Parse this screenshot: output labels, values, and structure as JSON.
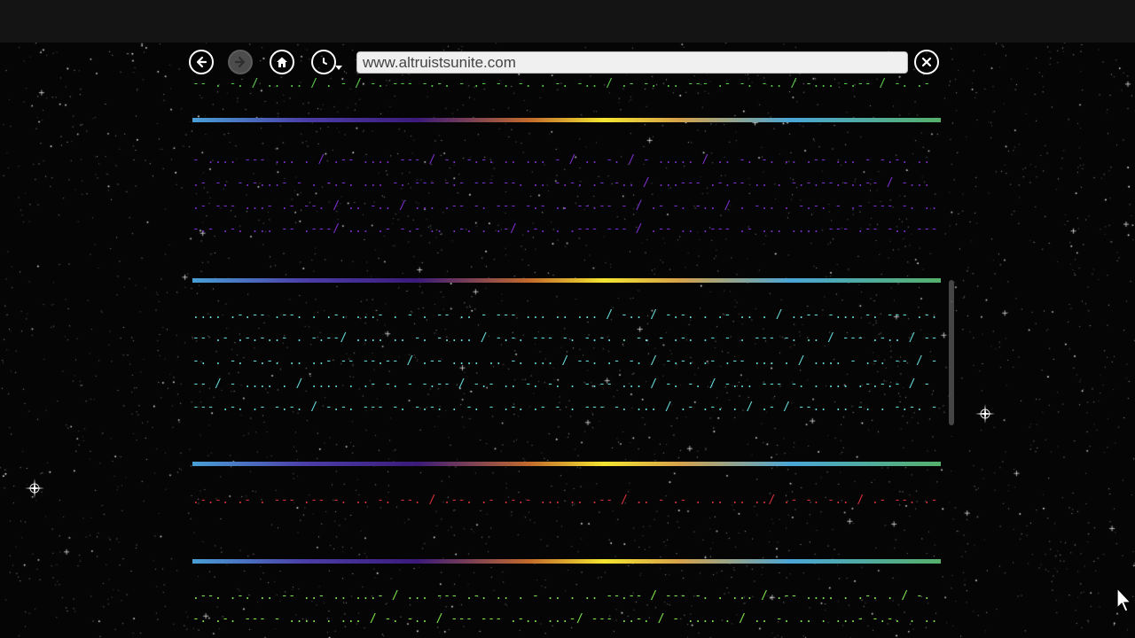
{
  "browser": {
    "url": "www.altruistsunite.com",
    "back_icon": "arrow-left-icon",
    "forward_icon": "arrow-right-icon",
    "home_icon": "home-icon",
    "history_icon": "clock-icon",
    "close_icon": "close-icon"
  },
  "content": {
    "line_top": "-- . -. / .. .. / . - / -. --- -.-. - .- -. -. . -. -.. / .- -. .. --- .- -. -.. / -... -.-- / -. .- - .- -. .- -.-.",
    "block_purple": "- .... --- ... . / .-- .... --- / -. -.-. .. ... - / .. -. / - ..... / .. -. -. .. .-- ... - -.-. .. .- -. -.-...- - . -.-. ... -. --- -.- --- --. .. -.-. .- -.. / ...--- .-.-- .. . -.-.--.-..-- / -... .- --- ...- .- --. / .. -.. / ... .-- -. --- -.- .. --.-- - / .- -. -.. / . -.. . -.-. - .- --- -. .. -.- .-. ... -- .---/ ... .- -.- .. .-. . .-/ .-. . .--- --- / .-- .. .--- .- ... .... --- .-- -.. --- -- . -.-.-.- -. / .-- .- ---- ..-. . .. -- .. .-.-",
    "block_cyan": ".... .-.-- .--. . .-. ...- . - . -- .. - --- ... .. ... / -.. / -.-. . .- .. . / ..-- -... -. --- .-. -- .- .-.-..- . -.--/ .... .. -. -.... / -.-. --- -. -.-. . -. - .-. .- - . --- -. .. / --- .-.. / -- -. . -. -.-. .. ..- -- --.-- / .-- .... .. -. ... / --. .- -. / -.-. .- .-- ... . / .... - .-. -- / --- / - .... . / .... . .- -. - -.-- / -.- .. -. -. . -.-- ... / -. -. / -... --- -. . ... .-.-.- / - --- .-. .- -.-. / -.-. --- -. -.-. . -. - .-. .- - . --- -. ... / .- .-. . / .- / --.. .. -. . -.-. - / -.-. . . ... .- .-.. - / --- .-. / . -.. .-. .-- --- ... .- .-. .- . / - --- / - .... . / ... .- -. .-.-.-",
    "block_red": ".-.-. .- . --- .-- -. .. -. --. / .--. .- .-.- ... .. .-- / .. - .- . .. .. ../ .- -. -.. / .- --. .-- -. . . .. .. .. .. --- -.",
    "block_green": ".--. .-. .. -- ..- .. ...- / ... --- .-. .. . - .. . .. --.-- / --- -. . ... / .-- .... . .-. . / -.-. .-. --- - .... . ... / -. -.. / --- --- .-.. ...-/ --- ..-. / - .... . / .. -. .. . ...- -.-. . .. -.-. / -.. .- -- -. .. -. . .. -.-- / .-- -- -. .-. . / .-. . . --- -. / --.. . .... -."
  },
  "colors": {
    "purple_text": "#7a2ec8",
    "cyan_text": "#62d4d4",
    "red_text": "#d8303a",
    "green_text": "#7ae04a",
    "top_text": "#58c84a"
  }
}
